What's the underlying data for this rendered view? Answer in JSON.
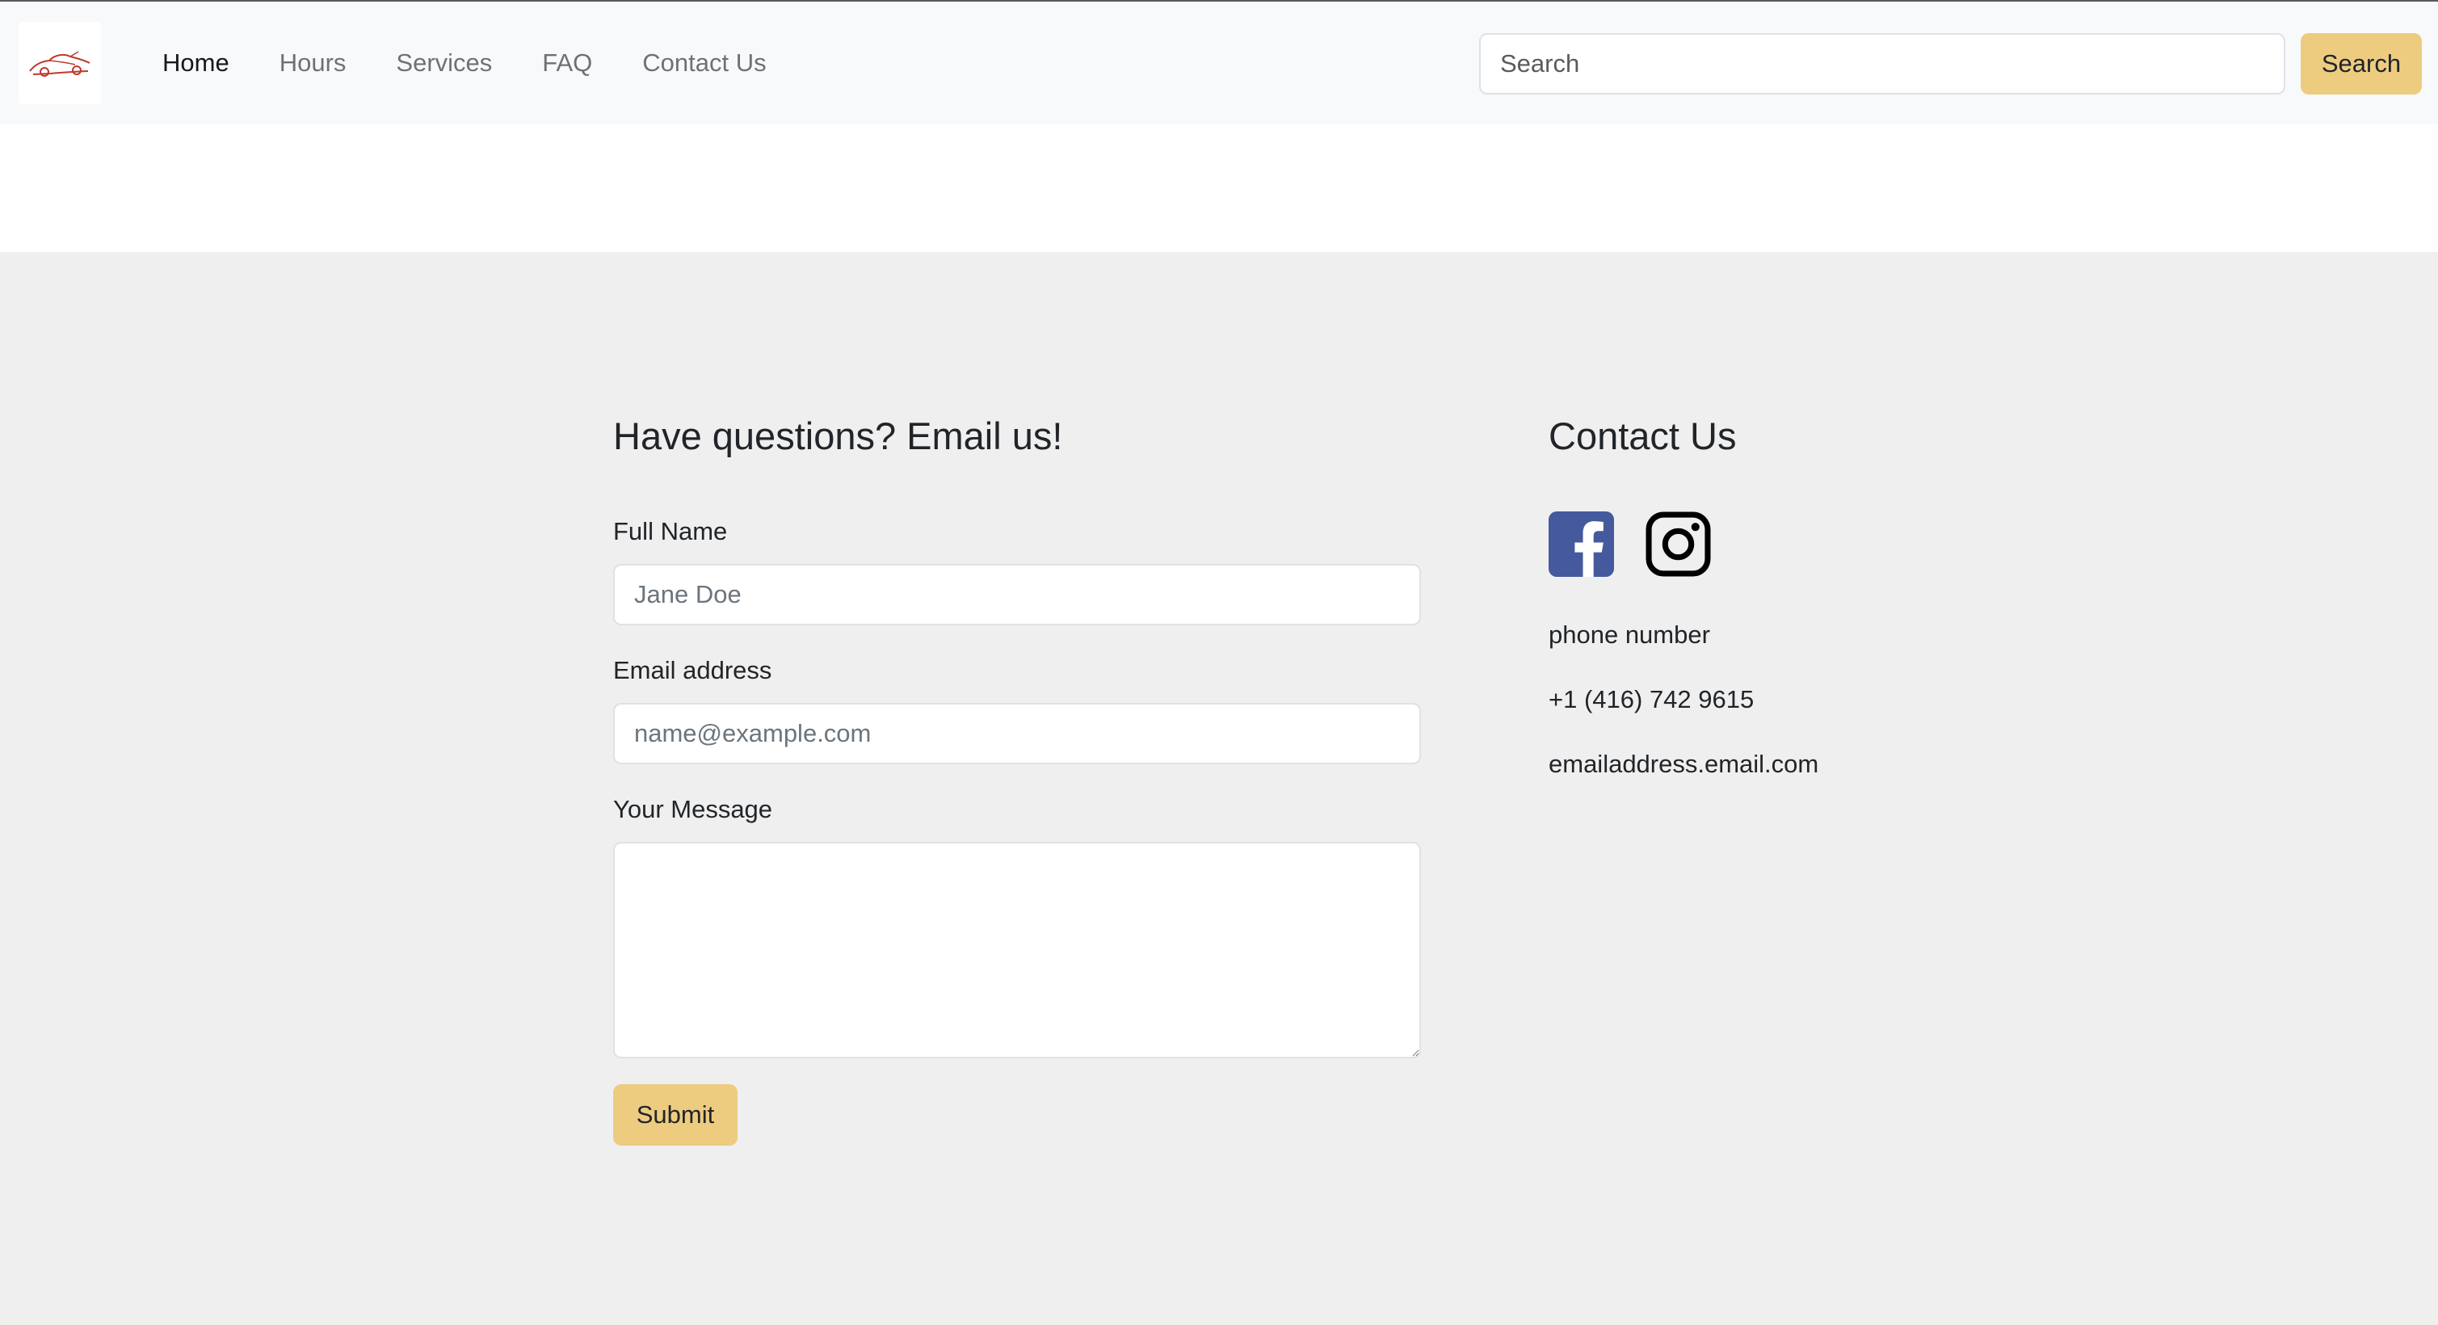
{
  "navbar": {
    "links": [
      {
        "label": "Home"
      },
      {
        "label": "Hours"
      },
      {
        "label": "Services"
      },
      {
        "label": "FAQ"
      },
      {
        "label": "Contact Us"
      }
    ],
    "search_placeholder": "Search",
    "search_button": "Search"
  },
  "form": {
    "title": "Have questions? Email us!",
    "name_label": "Full Name",
    "name_placeholder": "Jane Doe",
    "email_label": "Email address",
    "email_placeholder": "name@example.com",
    "message_label": "Your Message",
    "message_value": "",
    "submit_label": "Submit"
  },
  "contact": {
    "title": "Contact Us",
    "social": [
      {
        "icon": "facebook-icon"
      },
      {
        "icon": "instagram-icon"
      }
    ],
    "phone_label": "phone number",
    "phone": "+1 (416) 742 9615",
    "email": "emailaddress.email.com"
  },
  "colors": {
    "accent": "#edcc7f",
    "navbar_bg": "#f8f9fa",
    "page_bg": "#efefef",
    "facebook": "#45599d",
    "logo_car": "#c0392b"
  }
}
